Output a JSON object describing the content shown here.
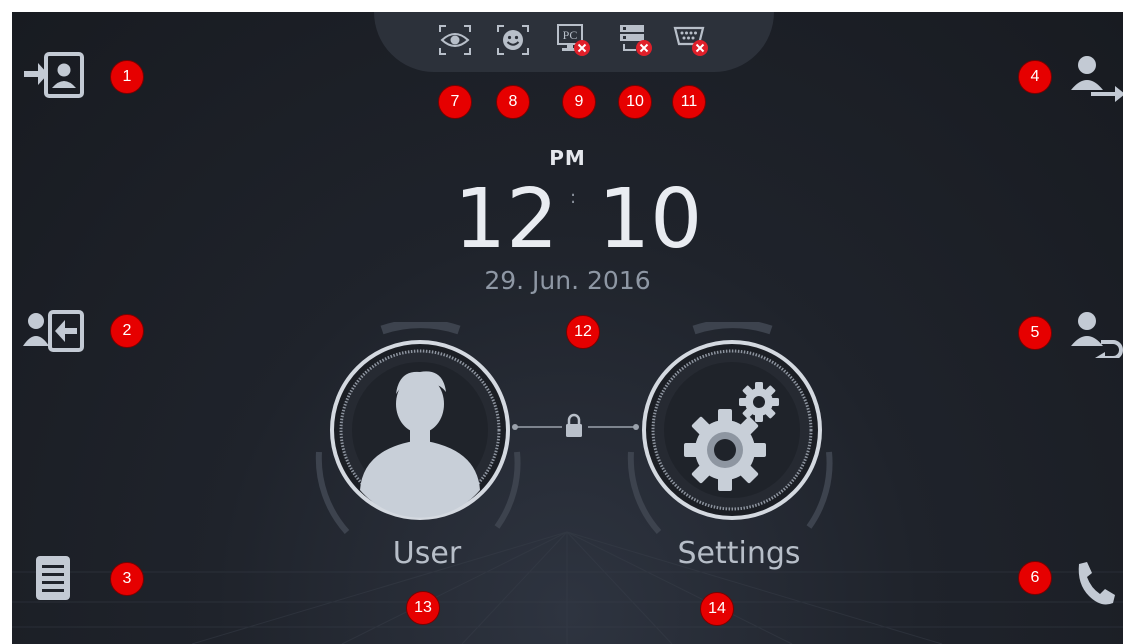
{
  "clock": {
    "ampm": "PM",
    "hours": "12",
    "separator": ":",
    "minutes": "10",
    "date": "29. Jun. 2016"
  },
  "main_buttons": {
    "user_label": "User",
    "settings_label": "Settings"
  },
  "status_icons": [
    {
      "icon": "eye-scan-icon",
      "error": false
    },
    {
      "icon": "face-scan-icon",
      "error": false
    },
    {
      "icon": "pc-connection-icon",
      "label": "PC",
      "error": true
    },
    {
      "icon": "network-server-icon",
      "error": true
    },
    {
      "icon": "serial-port-icon",
      "error": true
    }
  ],
  "side_buttons": {
    "left": [
      "login-icon",
      "logout-icon",
      "menu-list-icon"
    ],
    "right": [
      "user-transfer-icon",
      "user-return-icon",
      "phone-icon"
    ]
  },
  "markers": [
    "1",
    "2",
    "3",
    "4",
    "5",
    "6",
    "7",
    "8",
    "9",
    "10",
    "11",
    "12",
    "13",
    "14"
  ],
  "colors": {
    "background": "#1f232b",
    "icon": "#c3cad4",
    "marker": "#e60000",
    "error_badge": "#e0202a"
  }
}
